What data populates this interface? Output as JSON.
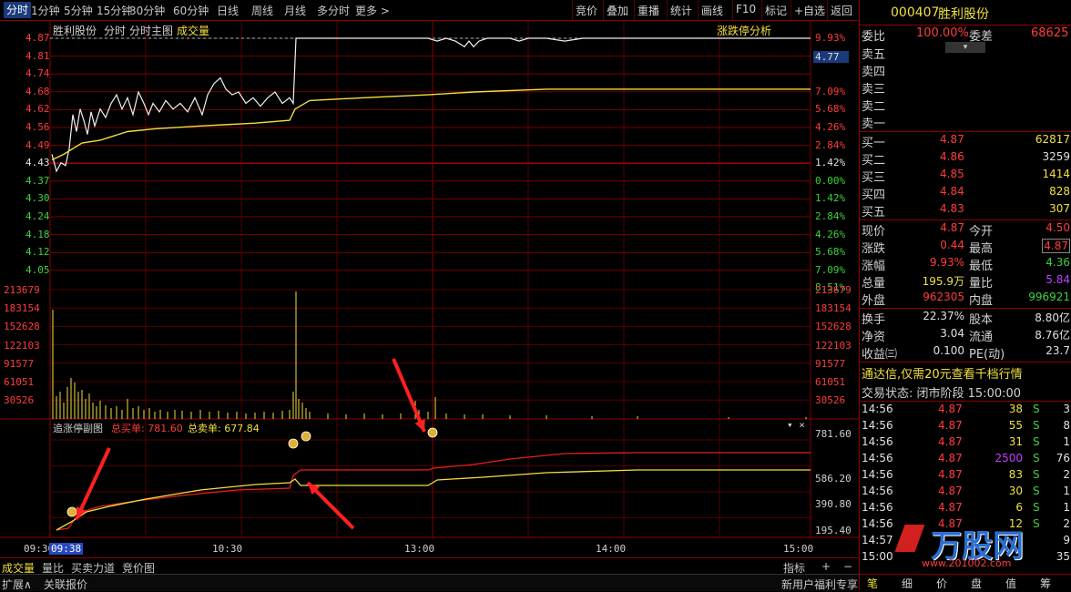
{
  "toolbar": {
    "periods": [
      "分时",
      "1分钟",
      "5分钟",
      "15分钟",
      "30分钟",
      "60分钟",
      "日线",
      "周线",
      "月线",
      "多分时",
      "更多 >"
    ],
    "tools": [
      "竞价",
      "叠加",
      "重播",
      "统计",
      "画线",
      "F10",
      "标记",
      "+自选",
      "返回"
    ]
  },
  "chart": {
    "legend": [
      "胜利股份",
      "分时",
      "分时主图",
      "成交量"
    ],
    "analysis_link": "涨跌停分析",
    "price_labels": [
      "4.87",
      "4.81",
      "4.74",
      "4.68",
      "4.62",
      "4.56",
      "4.49",
      "4.43",
      "4.37",
      "4.30",
      "4.24",
      "4.18",
      "4.12",
      "4.05"
    ],
    "pct_labels": [
      "9.93%",
      "7.09%",
      "5.68%",
      "4.26%",
      "2.84%",
      "1.42%",
      "0.00%",
      "1.42%",
      "2.84%",
      "4.26%",
      "5.68%",
      "7.09%",
      "8.51%"
    ],
    "current_price_tag": "4.77",
    "vol_labels": [
      "213679",
      "183154",
      "152628",
      "122103",
      "91577",
      "61051",
      "30526"
    ],
    "sub_title": "追涨停副图",
    "sub_buy_label": "总买单:",
    "sub_buy_value": "781.60",
    "sub_sell_label": "总卖单:",
    "sub_sell_value": "677.84",
    "sub_labels": [
      "781.60",
      "586.20",
      "390.80",
      "195.40"
    ],
    "sub_controls": "▾ ×",
    "time_labels": [
      "09:30",
      "09:38",
      "10:30",
      "13:00",
      "14:00",
      "15:00"
    ]
  },
  "tabs": [
    "成交量",
    "量比",
    "买卖力道",
    "竞价图"
  ],
  "tabs_right": [
    "指标",
    "+",
    "−"
  ],
  "status": {
    "left1": "扩展∧",
    "left2": "关联报价",
    "right": "新用户福利专享"
  },
  "panel": {
    "code": "000407",
    "name": "胜利股份",
    "wb_label": "委比",
    "wb_value": "100.00%",
    "wc_label": "委差",
    "wc_value": "68625",
    "sells": [
      {
        "label": "卖五"
      },
      {
        "label": "卖四"
      },
      {
        "label": "卖三"
      },
      {
        "label": "卖二"
      },
      {
        "label": "卖一"
      }
    ],
    "buys": [
      {
        "label": "买一",
        "price": "4.87",
        "vol": "62817"
      },
      {
        "label": "买二",
        "price": "4.86",
        "vol": "3259"
      },
      {
        "label": "买三",
        "price": "4.85",
        "vol": "1414"
      },
      {
        "label": "买四",
        "price": "4.84",
        "vol": "828"
      },
      {
        "label": "买五",
        "price": "4.83",
        "vol": "307"
      }
    ],
    "quote": [
      {
        "l1": "现价",
        "v1": "4.87",
        "l2": "今开",
        "v2": "4.50"
      },
      {
        "l1": "涨跌",
        "v1": "0.44",
        "l2": "最高",
        "v2": "4.87"
      },
      {
        "l1": "涨幅",
        "v1": "9.93%",
        "l2": "最低",
        "v2": "4.36"
      },
      {
        "l1": "总量",
        "v1": "195.9万",
        "l2": "量比",
        "v2": "5.84"
      },
      {
        "l1": "外盘",
        "v1": "962305",
        "l2": "内盘",
        "v2": "996921"
      }
    ],
    "extra": [
      {
        "l1": "换手",
        "v1": "22.37%",
        "l2": "股本",
        "v2": "8.80亿"
      },
      {
        "l1": "净资",
        "v1": "3.04",
        "l2": "流通",
        "v2": "8.76亿"
      },
      {
        "l1": "收益㈢",
        "v1": "0.100",
        "l2": "PE(动)",
        "v2": "23.7"
      }
    ],
    "ad": "通达信,仅需20元查看千档行情",
    "trade_status": "交易状态: 闭市阶段 15:00:00",
    "ticks": [
      {
        "t": "14:56",
        "p": "4.87",
        "v": "38",
        "s": "S",
        "n": "3"
      },
      {
        "t": "14:56",
        "p": "4.87",
        "v": "55",
        "s": "S",
        "n": "8"
      },
      {
        "t": "14:56",
        "p": "4.87",
        "v": "31",
        "s": "S",
        "n": "1"
      },
      {
        "t": "14:56",
        "p": "4.87",
        "v": "2500",
        "s": "S",
        "n": "76"
      },
      {
        "t": "14:56",
        "p": "4.87",
        "v": "83",
        "s": "S",
        "n": "2"
      },
      {
        "t": "14:56",
        "p": "4.87",
        "v": "30",
        "s": "S",
        "n": "1"
      },
      {
        "t": "14:56",
        "p": "4.87",
        "v": "6",
        "s": "S",
        "n": "1"
      },
      {
        "t": "14:56",
        "p": "4.87",
        "v": "12",
        "s": "S",
        "n": "2"
      },
      {
        "t": "14:57",
        "p": "",
        "v": "",
        "s": "",
        "n": "9"
      },
      {
        "t": "15:00",
        "p": "",
        "v": "",
        "s": "",
        "n": "35"
      }
    ],
    "bottom_tabs": [
      "笔",
      "细",
      "价",
      "盘",
      "值",
      "筹"
    ],
    "watermark": "万股网",
    "watermark_url": "www.201002.com"
  }
}
